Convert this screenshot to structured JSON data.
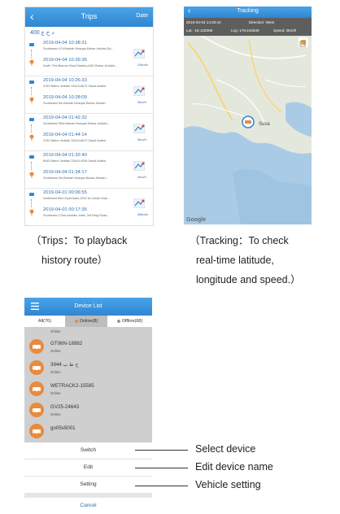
{
  "trips": {
    "title": "Trips",
    "date_label": "Date",
    "plate": "400 د ح ع",
    "items": [
      {
        "start_time": "2019-04-04 10:38:31",
        "start_addr": "Southwest 474,Bahrah Mosque,Bahra Jeddah,Sa...",
        "end_time": "2019-04-04 10:39:36",
        "end_addr": "North 79m,Banner Real Estates,4491 Bahra Jeddah...",
        "speed": "24km/h"
      },
      {
        "start_time": "2019-04-04 10:26:33",
        "start_addr": "4762 Bahra Jeddah 23443-8672 Saudi Arabia",
        "end_time": "2019-04-04 10:28:09",
        "end_addr": "Southwest 5m,Bahrah Mosque,Bahra Jeddah",
        "speed": "3km/h"
      },
      {
        "start_time": "2019-04-04 01:42:32",
        "start_addr": "Southwest 39m,Bahrah Mosque,Bahra Jeddah...",
        "end_time": "2019-04-04 01:44:14",
        "end_addr": "4762 Bahra Jeddah 23443-8672 Saudi Arabia",
        "speed": "5km/h"
      },
      {
        "start_time": "2019-04-04 01:32:40",
        "start_addr": "8545 Bahra Jeddah 23443-4296 Saudi Arabia",
        "end_time": "2019-04-04 01:34:17",
        "end_addr": "Southwest 3m,Bahrah Mosque,Bahra Jeddah...",
        "speed": "3km/h"
      },
      {
        "start_time": "2019-04-01 00:06:55",
        "start_addr": "Northwest 55m,Fyad bank,2537 Al Umrah Mak...",
        "end_time": "2019-04-01 00:17:36",
        "end_addr": "Southwest 17km,Awadla Jubia, 3rd Ring Road...",
        "speed": "48km/h"
      },
      {
        "start_time": "2019-03-31 23:26:02",
        "start_addr": "3760 Bahra Jeddah 23443-8672 Saudi Arabia",
        "end_time": "",
        "end_addr": "",
        "speed": ""
      }
    ]
  },
  "tracking": {
    "title": "Tracking",
    "time": "2019-04-04 14:30:44",
    "direction": "Direction: West",
    "lat": "Lat: -18.125398",
    "lng": "Lng: 178.444649",
    "speed": "Speed: 0km/h",
    "place": "Suva",
    "google": "Google"
  },
  "captions": {
    "trips_1": "（Trips：To playback",
    "trips_2": "history route）",
    "track_1": "（Tracking：To check",
    "track_2": "real-time latitude,",
    "track_3": "longitude and speed.）"
  },
  "device_list": {
    "title": "Device List",
    "tabs": [
      "All(76)",
      "Online(8)",
      "Offline(68)"
    ],
    "first_status": "Online",
    "devices": [
      {
        "name": "GT06N-18982",
        "status": "Online"
      },
      {
        "name": "3944 ح ط ب",
        "status": "Online"
      },
      {
        "name": "WETRACK2-15595",
        "status": "Online"
      },
      {
        "name": "GV25-24643",
        "status": "Online"
      },
      {
        "name": "go05s5001",
        "status": ""
      }
    ],
    "options": [
      "Switch",
      "Edit",
      "Setting"
    ],
    "cancel": "Cancel"
  },
  "callouts": {
    "switch": "Select device",
    "edit": "Edit device name",
    "setting": "Vehicle setting"
  },
  "colors": {
    "accent": "#2f86d2",
    "link": "#2b6fb3",
    "car": "#e98a3d"
  }
}
